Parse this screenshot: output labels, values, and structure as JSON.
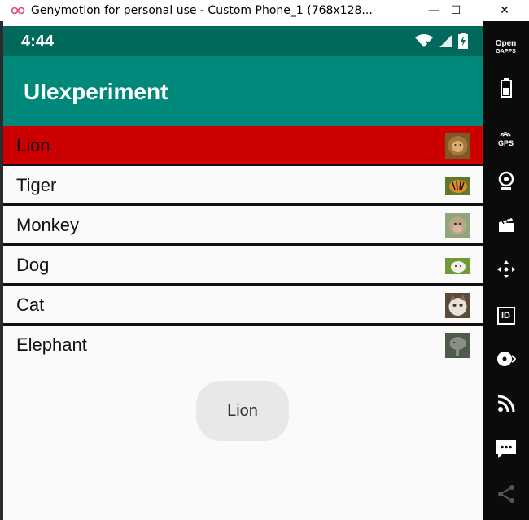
{
  "window": {
    "title": "Genymotion for personal use - Custom Phone_1 (768x128...",
    "minimize_glyph": "—",
    "maximize_glyph": "☐",
    "close_glyph": "✕"
  },
  "statusbar": {
    "time": "4:44"
  },
  "appbar": {
    "title": "UIexperiment"
  },
  "list": {
    "items": [
      {
        "label": "Lion",
        "selected": true,
        "thumb_icon": "lion-thumbnail"
      },
      {
        "label": "Tiger",
        "selected": false,
        "thumb_icon": "tiger-thumbnail"
      },
      {
        "label": "Monkey",
        "selected": false,
        "thumb_icon": "monkey-thumbnail"
      },
      {
        "label": "Dog",
        "selected": false,
        "thumb_icon": "dog-thumbnail"
      },
      {
        "label": "Cat",
        "selected": false,
        "thumb_icon": "cat-thumbnail"
      },
      {
        "label": "Elephant",
        "selected": false,
        "thumb_icon": "elephant-thumbnail"
      }
    ]
  },
  "toast": {
    "text": "Lion"
  },
  "sidebar": {
    "open_gapps": {
      "line1": "Open",
      "line2": "GAPPS"
    },
    "gps_label": "GPS",
    "id_label": "ID"
  },
  "colors": {
    "statusbar": "#00695c",
    "appbar": "#00897b",
    "selected_row": "#cc0000",
    "sidebar": "#0b0b0b"
  }
}
